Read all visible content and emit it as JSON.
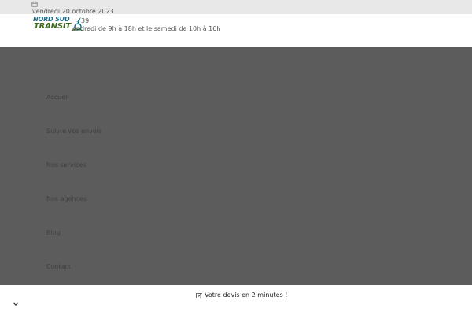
{
  "topbar": {
    "date": "vendredi 20 octobre 2023"
  },
  "header": {
    "logo_line1": "NORD SUD",
    "logo_line2": "TRANSIT",
    "phone_tail": "39",
    "hours": "endredi de 9h à 18h et le samedi de 10h à 16h"
  },
  "menu": {
    "items": [
      {
        "label": "Accueil"
      },
      {
        "label": "Suivre vos envois"
      },
      {
        "label": "Nos services"
      },
      {
        "label": "Nos agences"
      },
      {
        "label": "Blog"
      },
      {
        "label": "Contact"
      }
    ]
  },
  "footer": {
    "cta_label": "Votre devis en 2 minutes !"
  },
  "colors": {
    "overlay": "#5c5c5c",
    "topbar_bg": "#e8e8e8",
    "logo_blue": "#1a6f8a",
    "logo_green": "#3c6b1f"
  }
}
